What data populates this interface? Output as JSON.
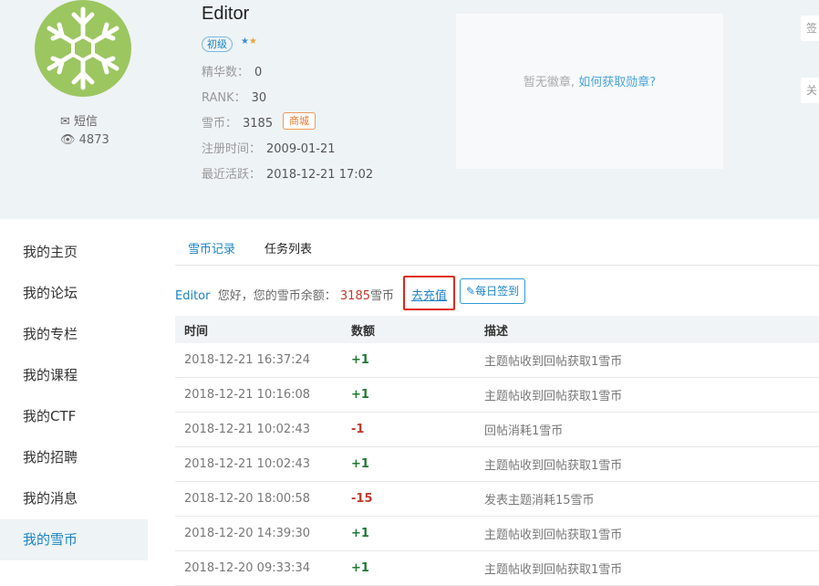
{
  "profile": {
    "username": "Editor",
    "level": "初级",
    "message_label": "短信",
    "views": "4873",
    "essence_label": "精华数：",
    "essence_value": "0",
    "rank_label": "RANK：",
    "rank_value": "30",
    "coins_label": "雪币：",
    "coins_value": "3185",
    "shop_label": "商城",
    "register_label": "注册时间：",
    "register_value": "2009-01-21",
    "active_label": "最近活跃：",
    "active_value": "2018-12-21 17:02"
  },
  "badges": {
    "empty_text": "暂无徽章,",
    "link_text": "如何获取勋章?"
  },
  "side_buttons": [
    "签",
    "关"
  ],
  "sidebar": {
    "items": [
      "我的主页",
      "我的论坛",
      "我的专栏",
      "我的课程",
      "我的CTF",
      "我的招聘",
      "我的消息",
      "我的雪币"
    ],
    "active": "我的雪币"
  },
  "tabs": [
    "雪币记录",
    "任务列表"
  ],
  "balance": {
    "name": "Editor",
    "text": "您好，您的雪币余额：",
    "amount": "3185",
    "unit": "雪币",
    "recharge": "去充值",
    "checkin": "每日签到"
  },
  "table": {
    "headers": [
      "时间",
      "数额",
      "描述"
    ],
    "rows": [
      {
        "time": "2018-12-21 16:37:24",
        "amount": "+1",
        "desc": "主题帖收到回帖获取1雪币"
      },
      {
        "time": "2018-12-21 10:16:08",
        "amount": "+1",
        "desc": "主题帖收到回帖获取1雪币"
      },
      {
        "time": "2018-12-21 10:02:43",
        "amount": "-1",
        "desc": "回帖消耗1雪币"
      },
      {
        "time": "2018-12-21 10:02:43",
        "amount": "+1",
        "desc": "主题帖收到回帖获取1雪币"
      },
      {
        "time": "2018-12-20 18:00:58",
        "amount": "-15",
        "desc": "发表主题消耗15雪币"
      },
      {
        "time": "2018-12-20 14:39:30",
        "amount": "+1",
        "desc": "主题帖收到回帖获取1雪币"
      },
      {
        "time": "2018-12-20 09:33:34",
        "amount": "+1",
        "desc": "主题帖收到回帖获取1雪币"
      }
    ]
  },
  "colors": {
    "accent": "#1a84c6",
    "positive": "#1d7a31",
    "negative": "#c0392b",
    "avatar_bg": "#9cc660",
    "highlight": "#e0261b"
  }
}
